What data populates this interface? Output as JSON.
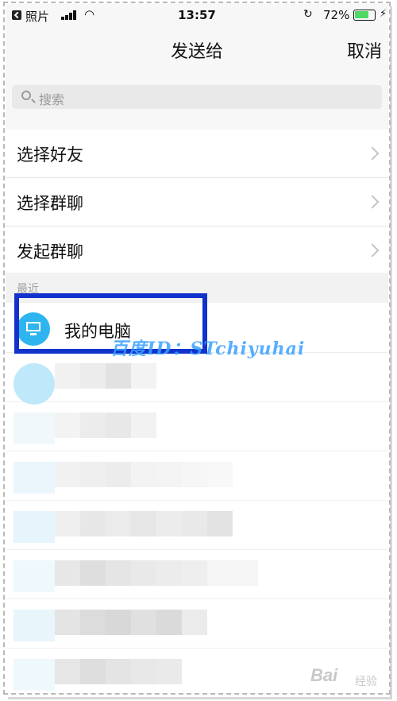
{
  "status_bar": {
    "carrier": "照片",
    "time": "13:57",
    "battery_percent": "72%",
    "battery_level": 0.72,
    "icons": [
      "back-icon",
      "signal-icon",
      "wifi-icon",
      "orientation-lock-icon",
      "battery-icon",
      "charging-icon"
    ]
  },
  "nav": {
    "title": "发送给",
    "cancel": "取消"
  },
  "search": {
    "placeholder": "搜索"
  },
  "menu": {
    "items": [
      {
        "label": "选择好友"
      },
      {
        "label": "选择群聊"
      },
      {
        "label": "发起群聊"
      }
    ]
  },
  "recent": {
    "section_label": "最近",
    "items": [
      {
        "name": "我的电脑",
        "icon": "computer-icon"
      }
    ]
  },
  "watermark": {
    "overlay": "百度ID：STchiyuhai",
    "logo": "Bai",
    "logo_sub": "经验"
  },
  "colors": {
    "accent_blue": "#2eb5f0",
    "highlight_box": "#1133cc",
    "battery_green": "#4cd964"
  }
}
